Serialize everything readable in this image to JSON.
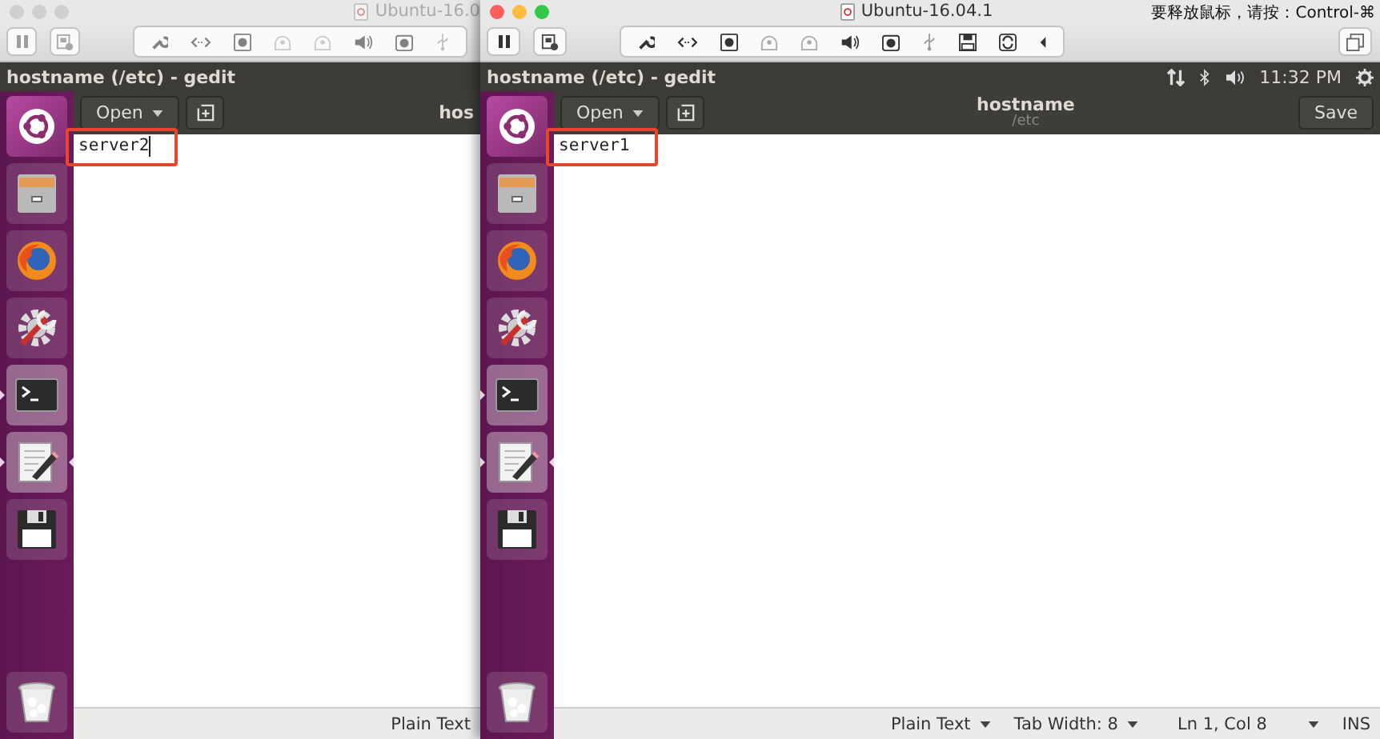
{
  "windows": [
    {
      "active": false,
      "title": "Ubuntu-16.0",
      "toolbar": [
        {
          "kind": "pause"
        },
        {
          "kind": "snapshot"
        },
        {
          "kind": "wrench"
        },
        {
          "kind": "connect"
        },
        {
          "kind": "disk"
        },
        {
          "kind": "hdd"
        },
        {
          "kind": "hdd"
        },
        {
          "kind": "speaker"
        },
        {
          "kind": "camera"
        },
        {
          "kind": "usb"
        }
      ],
      "panel_title": "hostname (/etc) - gedit",
      "launcher": [
        {
          "kind": "dash",
          "running": false,
          "focused": false
        },
        {
          "kind": "files",
          "running": false,
          "focused": false
        },
        {
          "kind": "browser",
          "running": false,
          "focused": false
        },
        {
          "kind": "settings",
          "running": false,
          "focused": false
        },
        {
          "kind": "terminal",
          "running": true,
          "focused": false
        },
        {
          "kind": "editor",
          "running": true,
          "focused": true
        },
        {
          "kind": "floppy",
          "running": false,
          "focused": false
        },
        {
          "kind": "trash",
          "running": false,
          "focused": false
        }
      ],
      "gedit": {
        "open_button": "Open",
        "title": "hos",
        "text": "server2",
        "cursor": true,
        "status": [
          {
            "kind": "label",
            "label": "Plain Text"
          }
        ]
      }
    },
    {
      "active": true,
      "title": "Ubuntu-16.04.1",
      "release_hint": "要释放鼠标，请按：Control-⌘",
      "toolbar": [
        {
          "kind": "pause"
        },
        {
          "kind": "snapshot"
        },
        {
          "kind": "wrench"
        },
        {
          "kind": "connect"
        },
        {
          "kind": "disk"
        },
        {
          "kind": "hdd"
        },
        {
          "kind": "hdd"
        },
        {
          "kind": "speaker"
        },
        {
          "kind": "camera"
        },
        {
          "kind": "usb"
        },
        {
          "kind": "floppy"
        },
        {
          "kind": "sync"
        },
        {
          "kind": "collapse"
        },
        {
          "kind": "restore"
        }
      ],
      "panel_title": "hostname (/etc) - gedit",
      "clock": "11:32 PM",
      "launcher": [
        {
          "kind": "dash",
          "running": false,
          "focused": false
        },
        {
          "kind": "files",
          "running": false,
          "focused": false
        },
        {
          "kind": "browser",
          "running": false,
          "focused": false
        },
        {
          "kind": "settings",
          "running": false,
          "focused": false
        },
        {
          "kind": "terminal",
          "running": true,
          "focused": false
        },
        {
          "kind": "editor",
          "running": true,
          "focused": true
        },
        {
          "kind": "floppy",
          "running": false,
          "focused": false
        },
        {
          "kind": "trash",
          "running": false,
          "focused": false
        }
      ],
      "gedit": {
        "open_button": "Open",
        "title": "hostname",
        "subtitle": "/etc",
        "save_button": "Save",
        "text": "server1",
        "cursor": false,
        "status": [
          {
            "kind": "dropdown",
            "label": "Plain Text"
          },
          {
            "kind": "dropdown",
            "label": "Tab Width: 8"
          },
          {
            "kind": "dropdown",
            "label": "Ln 1, Col 8"
          },
          {
            "kind": "label",
            "label": "INS"
          }
        ]
      }
    }
  ]
}
